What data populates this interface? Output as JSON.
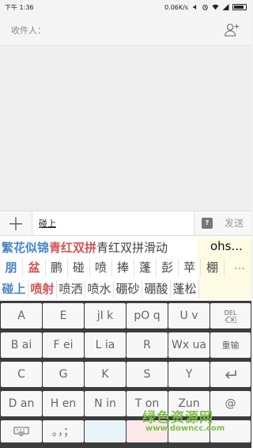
{
  "status_bar": {
    "time": "下午 1:36",
    "speed": "0.06K/s"
  },
  "recipient": {
    "label": "收件人："
  },
  "composer": {
    "text": "碰上",
    "help": "?",
    "send": "发送"
  },
  "candidates": {
    "row1": [
      "繁花似锦",
      "青红双拼",
      "青红双拼滑动"
    ],
    "ohs": "ohs...",
    "row2": [
      "朋",
      "盆",
      "鹏",
      "碰",
      "喷",
      "捧",
      "蓬",
      "彭",
      "苹",
      "棚"
    ],
    "more": "…",
    "row3": [
      "碰上",
      "喷射",
      "喷洒",
      "喷水",
      "硼砂",
      "硼酸",
      "蓬松"
    ]
  },
  "keyboard": {
    "row1": [
      "A",
      "E",
      "jI k",
      "pO q",
      "U v"
    ],
    "del": "DEL",
    "row2": [
      "B ai",
      "F ei",
      "L ia",
      "R",
      "Wx ua"
    ],
    "reenter": "重输",
    "row3": [
      "C",
      "G",
      "K",
      "S",
      "Y"
    ],
    "row4": [
      "D an",
      "H en",
      "N in",
      "T on",
      "Zun",
      "@"
    ],
    "punct": "。，；"
  },
  "watermark": {
    "line1": "绿色资源网",
    "line2": "www.downcc.com"
  }
}
